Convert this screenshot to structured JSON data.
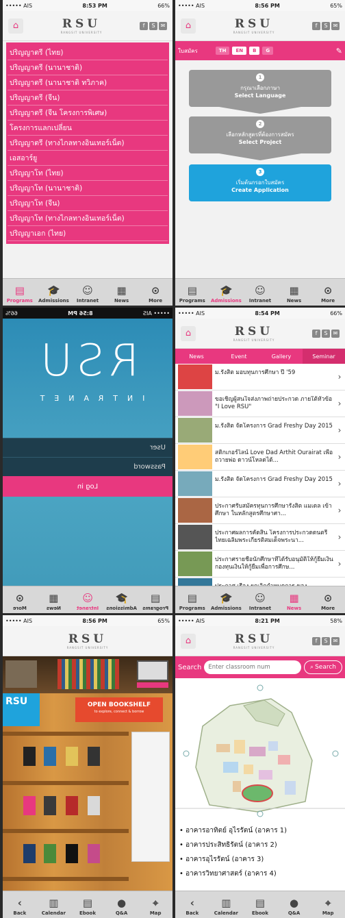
{
  "status": {
    "s1": {
      "carrier": "••••• AIS",
      "time": "8:53 PM",
      "battery": "66%"
    },
    "s2": {
      "carrier": "••••• AIS",
      "time": "8:56 PM",
      "battery": "65%"
    },
    "s3": {
      "carrier": "••••• AIS",
      "time": "8:56 PM",
      "battery": "66%"
    },
    "s4": {
      "carrier": "••••• AIS",
      "time": "8:54 PM",
      "battery": "66%"
    },
    "s5": {
      "carrier": "••••• AIS",
      "time": "8:56 PM",
      "battery": "65%"
    },
    "s6": {
      "carrier": "••••• AIS",
      "time": "8:21 PM",
      "battery": "58%"
    }
  },
  "logo": {
    "text": "RSU",
    "sub": "RANGSIT UNIVERSITY"
  },
  "tabs_main": [
    "Programs",
    "Admissions",
    "Intranet",
    "News",
    "More"
  ],
  "tabs_library": [
    "Back",
    "Calendar",
    "Ebook",
    "Q&A",
    "Map"
  ],
  "programs": [
    "ปริญญาตรี (ไทย)",
    "ปริญญาตรี (นานาชาติ)",
    "ปริญญาตรี (นานาชาติ ทวิภาค)",
    "ปริญญาตรี (จีน)",
    "ปริญญาตรี (จีน โครงการพิเศษ)",
    "โครงการแลกเปลี่ยน",
    "ปริญญาตรี (ทางไกลทางอินเทอร์เน็ต)",
    "เอสอาร์ยู",
    "ปริญญาโท (ไทย)",
    "ปริญญาโท (นานาชาติ)",
    "ปริญญาโท (จีน)",
    "ปริญญาโท (ทางไกลทางอินเทอร์เน็ต)",
    "ปริญญาเอก (ไทย)"
  ],
  "admission": {
    "label": "ใบสมัคร",
    "langs": [
      "TH",
      "EN",
      "B",
      "G"
    ],
    "steps": [
      {
        "num": "1",
        "th": "กรุณาเลือกภาษา",
        "en": "Select Language"
      },
      {
        "num": "2",
        "th": "เลือกหลักสูตรที่ต้องการสมัคร",
        "en": "Select Project"
      },
      {
        "num": "3",
        "th": "เริ่มต้นกรอกใบสมัคร",
        "en": "Create Application"
      }
    ]
  },
  "intranet": {
    "logo": "RSU",
    "sub": "INTRANET",
    "user": "User",
    "password": "Password",
    "login": "Log in"
  },
  "news": {
    "tabs": [
      "News",
      "Event",
      "Gallery",
      "Seminar"
    ],
    "items": [
      "ม.รังสิต มอบทุนการศึกษา ปี '59",
      "ขอเชิญผู้สนใจส่งภาพถ่ายประกวด ภายใต้หัวข้อ \"I Love RSU\"",
      "ม.รังสิต จัดโครงการ Grad Freshy Day 2015",
      "สติกเกอร์ไลน์ Love Dad Arthit Ourairat เพื่อถวายพ่อ ดาวน์โหลดได้...",
      "ม.รังสิต จัดโครงการ Grad Freshy Day 2015",
      "ประกาศรับสมัครทุนการศึกษารังสิต แมเดล เข้าศึกษา ในหลักสูตรศึกษาศา...",
      "ประกาศผลการคัดสิน โครงการประกวดดนตรีไทยเฉลิมพระเกียรติสมเด็จพระนา...",
      "ประกาศรายชื่อนักศึกษาที่ได้รับอนุมัติให้กู้ยืมเงินกองทุนเงินให้กู้ยืมเพื่อการศึกษ...",
      "ประกาศ เรื่อง ยกเลิกกำหนดการ ของ"
    ]
  },
  "library": {
    "logo": "RSU",
    "banner_title": "OPEN BOOKSHELF",
    "banner_sub": "to explore, connect & borrow"
  },
  "map": {
    "search_label": "Search",
    "placeholder": "Enter classroom num",
    "search_btn": "Search",
    "buildings": [
      "• อาคารอาทิตย์ อุไรรัตน์ (อาคาร 1)",
      "• อาคารประสิทธิรัตน์ (อาคาร 2)",
      "• อาคารอุไรรัตน์ (อาคาร 3)",
      "• อาคารวิทยาศาสตร์ (อาคาร 4)"
    ]
  },
  "colors": {
    "accent": "#e8387f",
    "blue": "#1fa3dc"
  }
}
